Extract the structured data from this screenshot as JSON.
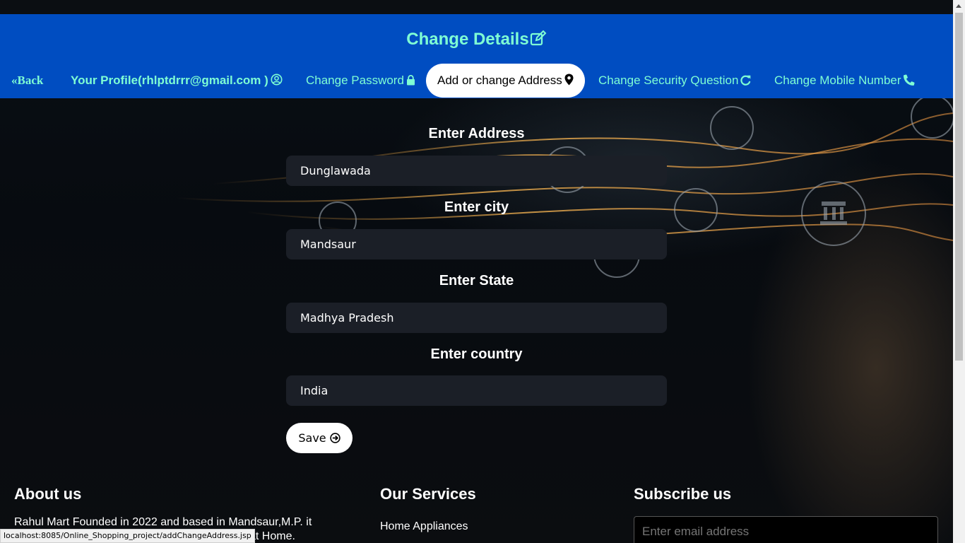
{
  "header": {
    "title": "Change Details",
    "nav": {
      "back": "Back",
      "profile": "Your Profile(rhlptdrrr@gmail.com )",
      "change_password": "Change Password",
      "address": "Add or change Address",
      "security": "Change Security Question",
      "mobile": "Change Mobile Number"
    }
  },
  "form": {
    "address_label": "Enter Address",
    "address_value": "Dunglawada",
    "city_label": "Enter city",
    "city_value": "Mandsaur",
    "state_label": "Enter State",
    "state_value": "Madhya Pradesh",
    "country_label": "Enter country",
    "country_value": "India",
    "save_label": "Save"
  },
  "footer": {
    "about_heading": "About us",
    "about_text_line1": "Rahul Mart Founded in 2022 and based in Mandsaur,M.P. it",
    "about_text_line2": "at Home.",
    "services_heading": "Our Services",
    "service_1": "Home Appliances",
    "subscribe_heading": "Subscribe us",
    "subscribe_placeholder": "Enter email address"
  },
  "status_bar": {
    "url": "localhost:8085/Online_Shopping_project/addChangeAddress.jsp"
  },
  "colors": {
    "header_bg": "#004dc1",
    "nav_text": "#7fffd4",
    "input_bg": "#1b1f27"
  }
}
